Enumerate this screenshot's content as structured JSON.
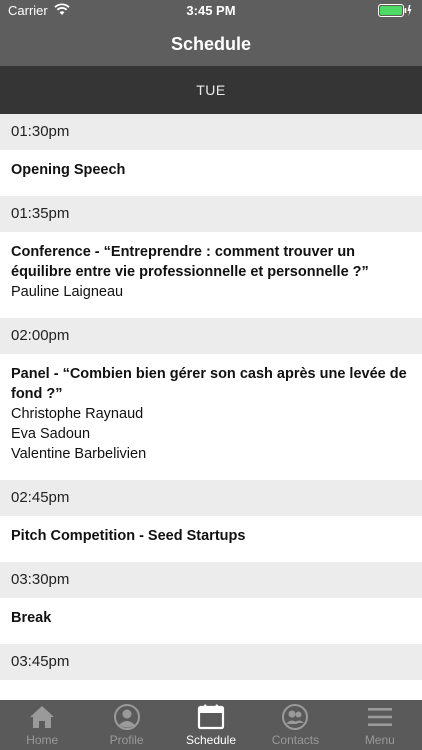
{
  "status_bar": {
    "carrier": "Carrier",
    "time": "3:45 PM"
  },
  "nav": {
    "title": "Schedule"
  },
  "day": {
    "label": "TUE"
  },
  "schedule": [
    {
      "time": "01:30pm",
      "title": "Opening Speech",
      "speakers": []
    },
    {
      "time": "01:35pm",
      "title": "Conference - “Entreprendre : comment trouver un équilibre entre vie professionnelle et personnelle ?”",
      "speakers": [
        "Pauline Laigneau"
      ]
    },
    {
      "time": "02:00pm",
      "title": "Panel - “Combien bien gérer son cash après une levée de fond ?”",
      "speakers": [
        "Christophe Raynaud",
        "Eva Sadoun",
        "Valentine Barbelivien"
      ]
    },
    {
      "time": "02:45pm",
      "title": "Pitch Competition - Seed Startups",
      "speakers": []
    },
    {
      "time": "03:30pm",
      "title": "Break",
      "speakers": []
    },
    {
      "time": "03:45pm",
      "title": "",
      "speakers": []
    }
  ],
  "tabs": [
    {
      "label": "Home",
      "icon": "home-icon",
      "active": false
    },
    {
      "label": "Profile",
      "icon": "profile-icon",
      "active": false
    },
    {
      "label": "Schedule",
      "icon": "calendar-icon",
      "active": true
    },
    {
      "label": "Contacts",
      "icon": "contacts-icon",
      "active": false
    },
    {
      "label": "Menu",
      "icon": "menu-icon",
      "active": false
    }
  ],
  "colors": {
    "header": "#5e5e5e",
    "day_bar": "#353535",
    "time_row": "#ececec",
    "tab_bar": "#5a5a5a",
    "battery": "#4cd964"
  }
}
